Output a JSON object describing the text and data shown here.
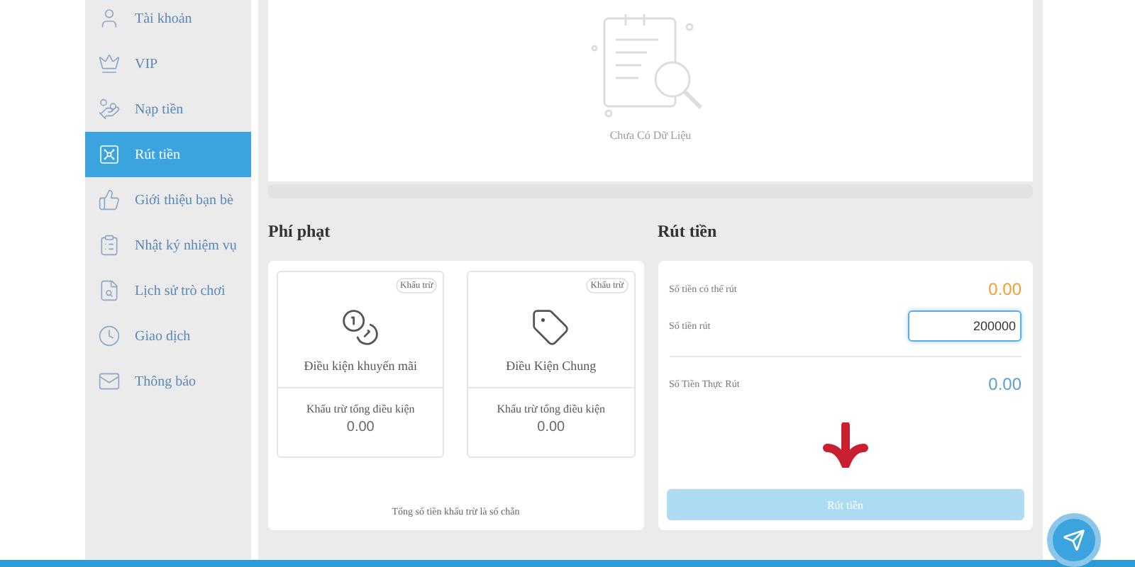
{
  "sidebar": {
    "items": [
      {
        "label": "Tài khoản",
        "selected": false
      },
      {
        "label": "VIP",
        "selected": false
      },
      {
        "label": "Nạp tiền",
        "selected": false
      },
      {
        "label": "Rút tiền",
        "selected": true
      },
      {
        "label": "Giới thiệu bạn bè",
        "selected": false
      },
      {
        "label": "Nhật ký nhiệm vụ",
        "selected": false
      },
      {
        "label": "Lịch sử trò chơi",
        "selected": false
      },
      {
        "label": "Giao dịch",
        "selected": false
      },
      {
        "label": "Thông báo",
        "selected": false
      }
    ]
  },
  "records": {
    "empty_text": "Chưa Có Dữ Liệu"
  },
  "penalty": {
    "title": "Phí phạt",
    "cards": [
      {
        "badge": "Khấu trừ",
        "title": "Điều kiện khuyến mãi",
        "sub_label": "Khấu trừ tổng điều kiện",
        "value": "0.00"
      },
      {
        "badge": "Khấu trừ",
        "title": "Điều Kiện Chung",
        "sub_label": "Khấu trừ tổng điều kiện",
        "value": "0.00"
      }
    ],
    "footnote": "Tổng số tiền khấu trừ là số chẵn"
  },
  "withdraw": {
    "title": "Rút tiền",
    "available": {
      "label": "Số tiền có thể rút",
      "value": "0.00"
    },
    "amount": {
      "label": "Số tiền rút",
      "value": "200000"
    },
    "actual": {
      "label": "Số Tiền Thực Rút",
      "value": "0.00"
    },
    "button": {
      "label": "Rút tiền",
      "disabled": true
    }
  }
}
